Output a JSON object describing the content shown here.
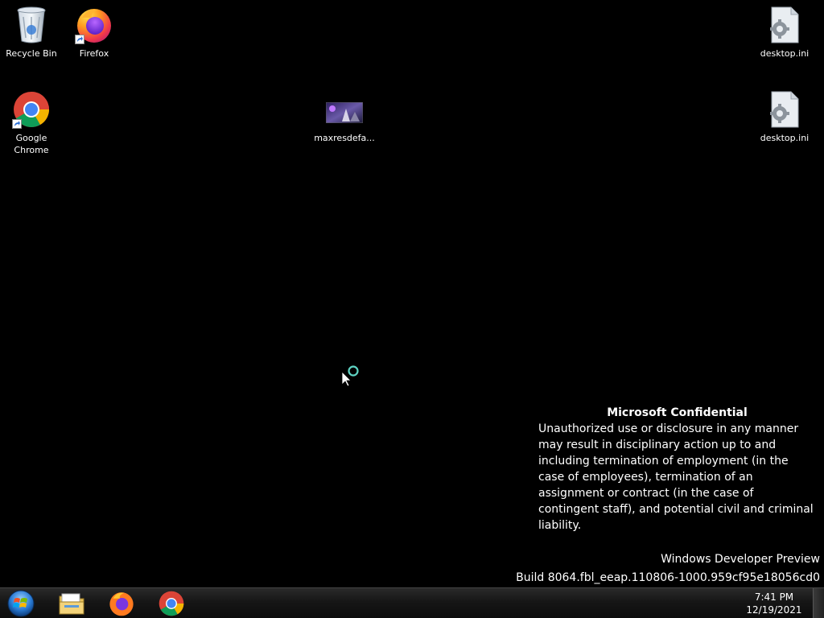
{
  "desktop": {
    "icons": {
      "recycle_bin": "Recycle Bin",
      "firefox": "Firefox",
      "chrome": "Google Chrome",
      "maxres": "maxresdefa...",
      "desktop_ini_1": "desktop.ini",
      "desktop_ini_2": "desktop.ini"
    }
  },
  "watermark": {
    "confidential_title": "Microsoft Confidential",
    "confidential_body": "Unauthorized use or disclosure in any manner may result in disciplinary action up to and including termination of employment (in the case of employees), termination of an assignment or contract (in the case of contingent staff), and potential civil and criminal liability.",
    "edition": "Windows Developer Preview",
    "build": "Build 8064.fbl_eeap.110806-1000.959cf95e18056cd0"
  },
  "taskbar": {
    "pinned": [
      "file-explorer-icon",
      "firefox-icon",
      "chrome-icon"
    ],
    "time": "7:41 PM",
    "date": "12/19/2021"
  },
  "colors": {
    "background": "#000000",
    "taskbar": "#161616"
  }
}
